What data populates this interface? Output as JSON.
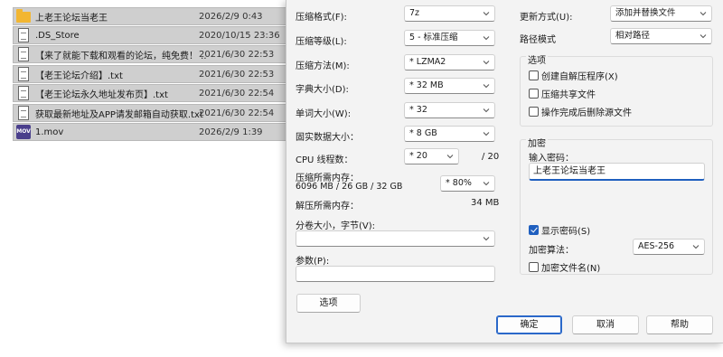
{
  "files": [
    {
      "name": "上老王论坛当老王",
      "date": "2026/2/9 0:43",
      "icon": "folder-icon"
    },
    {
      "name": ".DS_Store",
      "date": "2020/10/15 23:36",
      "icon": "file-icon"
    },
    {
      "name": "【来了就能下载和观看的论坛，纯免费！ ...",
      "date": "2021/6/30 22:53",
      "icon": "text-file-icon"
    },
    {
      "name": "【老王论坛介绍】.txt",
      "date": "2021/6/30 22:53",
      "icon": "text-file-icon"
    },
    {
      "name": "【老王论坛永久地址发布页】.txt",
      "date": "2021/6/30 22:54",
      "icon": "text-file-icon"
    },
    {
      "name": "获取最新地址及APP请发邮箱自动获取.txt",
      "date": "2021/6/30 22:54",
      "icon": "text-file-icon"
    },
    {
      "name": "1.mov",
      "date": "2026/2/9 1:39",
      "icon": "video-file-icon",
      "icon_text": "MOV"
    }
  ],
  "dialog": {
    "format_label": "压缩格式(F):",
    "format_value": "7z",
    "level_label": "压缩等级(L):",
    "level_value": "5 - 标准压缩",
    "method_label": "压缩方法(M):",
    "method_value": "* LZMA2",
    "dict_label": "字典大小(D):",
    "dict_value": "* 32 MB",
    "word_label": "单词大小(W):",
    "word_value": "* 32",
    "solid_label": "固实数据大小：",
    "solid_value": "* 8 GB",
    "cpu_label": "CPU 线程数：",
    "cpu_value": "* 20",
    "cpu_total": "/ 20",
    "mem_comp_label": "压缩所需内存：",
    "mem_comp_detail": "6096 MB / 26 GB / 32 GB",
    "mem_comp_pct": "* 80%",
    "mem_decomp_label": "解压所需内存：",
    "mem_decomp_value": "34 MB",
    "split_label": "分卷大小，字节(V):",
    "split_value": "",
    "params_label": "参数(P):",
    "params_value": "",
    "options_button": "选项",
    "update_label": "更新方式(U):",
    "update_value": "添加并替换文件",
    "path_label": "路径模式",
    "path_value": "相对路径",
    "options_group": "选项",
    "opt_sfx": "创建自解压程序(X)",
    "opt_shared": "压缩共享文件",
    "opt_delete": "操作完成后删除源文件",
    "encrypt_group": "加密",
    "password_label": "输入密码：",
    "password_value": "上老王论坛当老王",
    "show_password": "显示密码(S)",
    "enc_method_label": "加密算法：",
    "enc_method_value": "AES-256",
    "enc_names": "加密文件名(N)",
    "ok_button": "确定",
    "cancel_button": "取消",
    "help_button": "帮助"
  },
  "colors": {
    "accent": "#1f5fbf",
    "folder": "#f2b632",
    "selection": "#cfcfcf"
  }
}
